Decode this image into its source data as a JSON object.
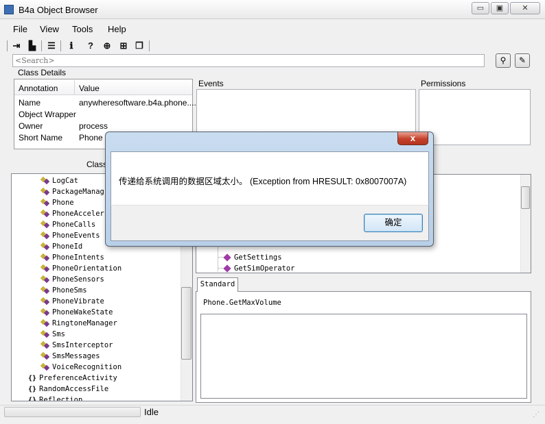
{
  "window": {
    "title": "B4a Object Browser",
    "minimize": "▭",
    "maximize": "▣",
    "close": "✕"
  },
  "menu": [
    "File",
    "View",
    "Tools",
    "Help"
  ],
  "toolbar_icons": [
    "exit-icon",
    "new-file-icon",
    "list-icon",
    "info-icon",
    "help-icon",
    "globe-icon",
    "gift-icon",
    "copy-icon"
  ],
  "search": {
    "placeholder": "<Search>"
  },
  "class_details": {
    "label": "Class Details",
    "headers": [
      "Annotation",
      "Value"
    ],
    "rows": [
      {
        "annotation": "Name",
        "value": "anywheresoftware.b4a.phone...."
      },
      {
        "annotation": "Object Wrapper",
        "value": ""
      },
      {
        "annotation": "Owner",
        "value": "process"
      },
      {
        "annotation": "Short Name",
        "value": "Phone"
      }
    ]
  },
  "events_label": "Events",
  "permissions_label": "Permissions",
  "classes_label": "Classe",
  "tree": {
    "children": [
      "LogCat",
      "PackageManag",
      "Phone",
      "PhoneAcceler",
      "PhoneCalls",
      "PhoneEvents",
      "PhoneId",
      "PhoneIntents",
      "PhoneOrientation",
      "PhoneSensors",
      "PhoneSms",
      "PhoneVibrate",
      "PhoneWakeState",
      "RingtoneManager",
      "Sms",
      "SmsInterceptor",
      "SmsMessages",
      "VoiceRecognition"
    ],
    "libraries": [
      "PreferenceActivity",
      "RandomAccessFile",
      "Reflection"
    ]
  },
  "members": [
    "GetSettings",
    "GetSimOperator"
  ],
  "tab_label": "Standard",
  "signature": "Phone.GetMaxVolume",
  "status": "Idle",
  "dialog": {
    "message": "传递给系统调用的数据区域太小。 (Exception from HRESULT: 0x8007007A)",
    "ok": "确定",
    "close": "x"
  }
}
